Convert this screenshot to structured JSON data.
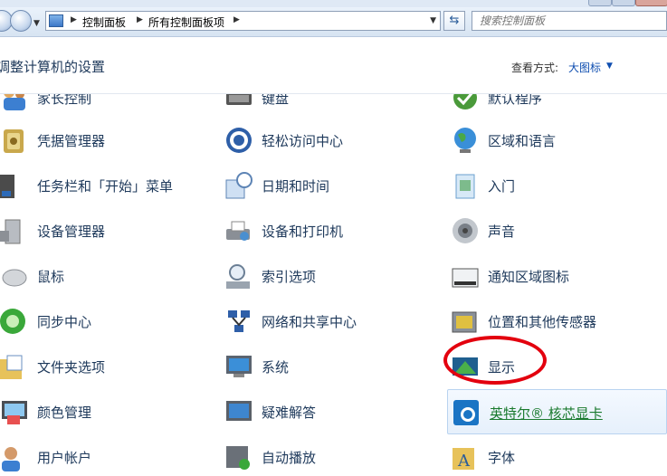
{
  "address_bar": {
    "breadcrumbs": [
      "控制面板",
      "所有控制面板项"
    ],
    "search_placeholder": "搜索控制面板"
  },
  "header": {
    "title": "调整计算机的设置",
    "view_label": "查看方式:",
    "view_value": "大图标"
  },
  "items": [
    {
      "label": "家长控制",
      "icon": "parental-controls-icon"
    },
    {
      "label": "键盘",
      "icon": "keyboard-icon"
    },
    {
      "label": "默认程序",
      "icon": "default-programs-icon"
    },
    {
      "label": "凭据管理器",
      "icon": "credential-manager-icon"
    },
    {
      "label": "轻松访问中心",
      "icon": "ease-of-access-icon"
    },
    {
      "label": "区域和语言",
      "icon": "globe-icon"
    },
    {
      "label": "任务栏和「开始」菜单",
      "icon": "taskbar-icon"
    },
    {
      "label": "日期和时间",
      "icon": "calendar-clock-icon"
    },
    {
      "label": "入门",
      "icon": "getting-started-icon"
    },
    {
      "label": "设备管理器",
      "icon": "device-manager-icon"
    },
    {
      "label": "设备和打印机",
      "icon": "printer-icon"
    },
    {
      "label": "声音",
      "icon": "speaker-icon"
    },
    {
      "label": "鼠标",
      "icon": "mouse-icon"
    },
    {
      "label": "索引选项",
      "icon": "indexing-icon"
    },
    {
      "label": "通知区域图标",
      "icon": "notification-area-icon"
    },
    {
      "label": "同步中心",
      "icon": "sync-icon"
    },
    {
      "label": "网络和共享中心",
      "icon": "network-icon"
    },
    {
      "label": "位置和其他传感器",
      "icon": "location-sensor-icon"
    },
    {
      "label": "文件夹选项",
      "icon": "folder-options-icon"
    },
    {
      "label": "系统",
      "icon": "system-icon"
    },
    {
      "label": "显示",
      "icon": "display-icon"
    },
    {
      "label": "颜色管理",
      "icon": "color-management-icon"
    },
    {
      "label": "疑难解答",
      "icon": "troubleshooting-icon"
    },
    {
      "label": "英特尔® 核芯显卡",
      "icon": "intel-graphics-icon"
    },
    {
      "label": "用户帐户",
      "icon": "user-accounts-icon"
    },
    {
      "label": "自动播放",
      "icon": "autoplay-icon"
    },
    {
      "label": "字体",
      "icon": "fonts-icon"
    }
  ]
}
